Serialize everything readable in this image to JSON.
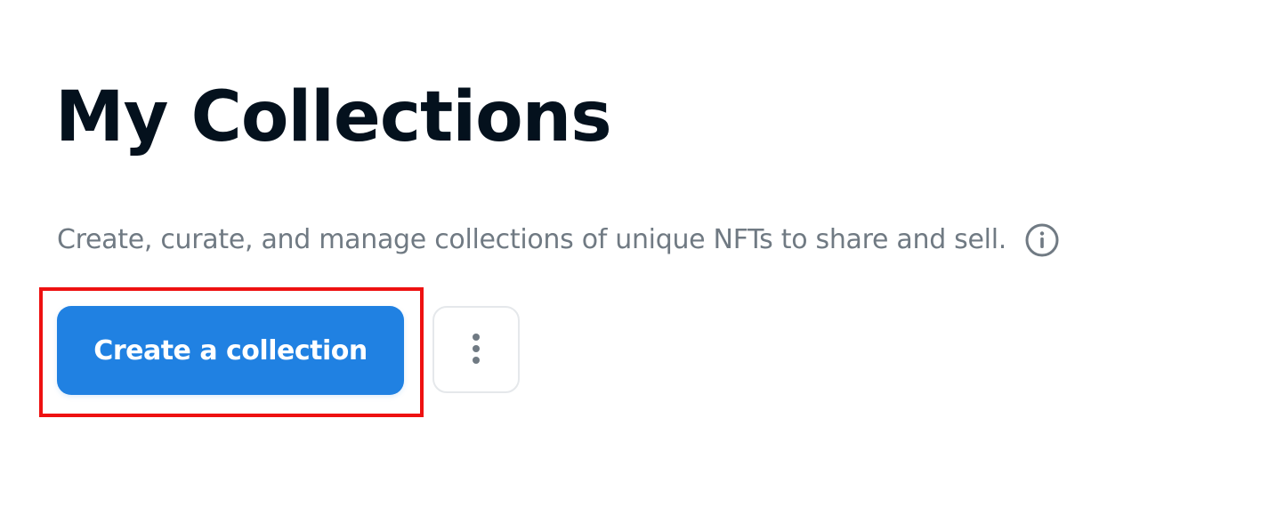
{
  "header": {
    "title": "My Collections",
    "subtitle": "Create, curate, and manage collections of unique NFTs to share and sell."
  },
  "actions": {
    "create_label": "Create a collection",
    "more_icon": "more-vertical-icon"
  },
  "icons": {
    "info": "info-icon"
  },
  "colors": {
    "primary": "#2081e2",
    "title": "#04111d",
    "subtitle": "#707a83",
    "highlight": "#ee1111",
    "border": "#e5e8eb"
  }
}
